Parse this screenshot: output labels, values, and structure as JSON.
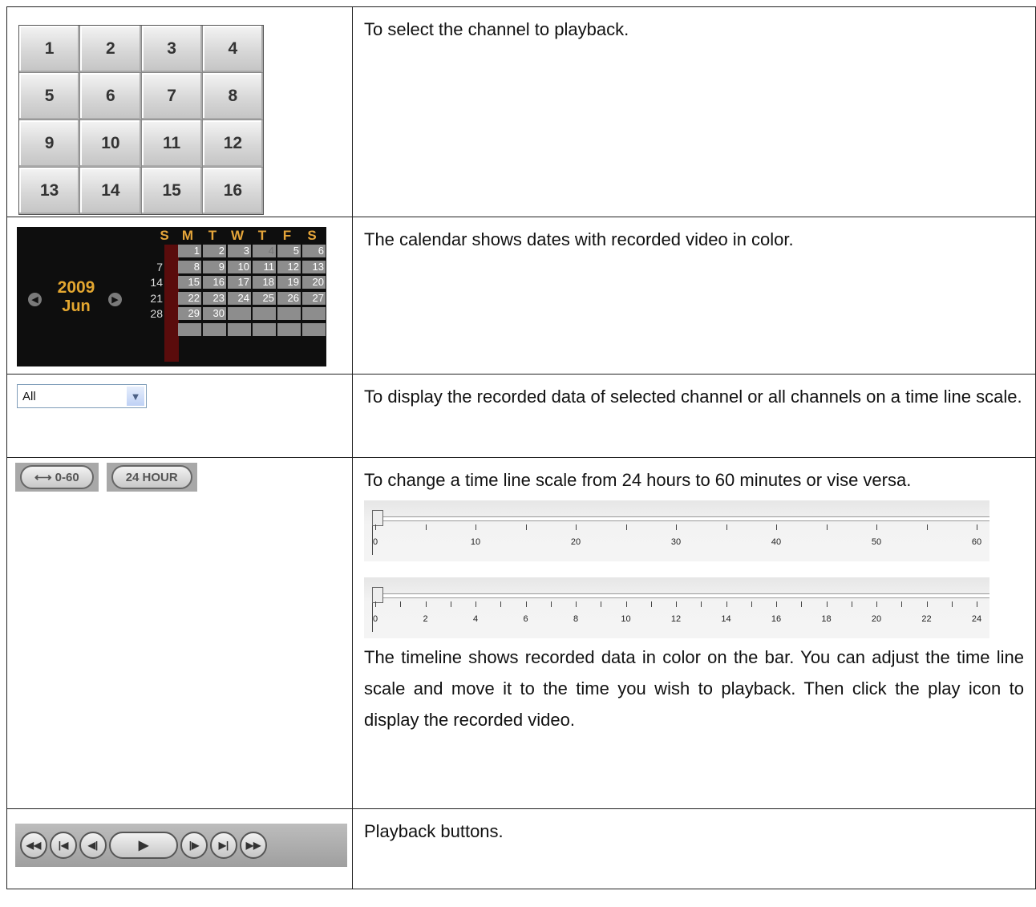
{
  "rows": {
    "channel": {
      "buttons": [
        "1",
        "2",
        "3",
        "4",
        "5",
        "6",
        "7",
        "8",
        "9",
        "10",
        "11",
        "12",
        "13",
        "14",
        "15",
        "16"
      ],
      "description": "To select the channel to playback."
    },
    "calendar": {
      "year": "2009",
      "month": "Jun",
      "day_headers": [
        "S",
        "M",
        "T",
        "W",
        "T",
        "F",
        "S"
      ],
      "week_labels": [
        "7",
        "14",
        "21",
        "28"
      ],
      "weeks": [
        [
          "",
          "1",
          "2",
          "3",
          "4",
          "5",
          "6"
        ],
        [
          "7",
          "8",
          "9",
          "10",
          "11",
          "12",
          "13"
        ],
        [
          "14",
          "15",
          "16",
          "17",
          "18",
          "19",
          "20"
        ],
        [
          "21",
          "22",
          "23",
          "24",
          "25",
          "26",
          "27"
        ],
        [
          "28",
          "29",
          "30",
          "",
          "",
          "",
          ""
        ],
        [
          "",
          "",
          "",
          "",
          "",
          "",
          ""
        ]
      ],
      "dim_days": [
        "4"
      ],
      "description": "The calendar shows dates with recorded video in color."
    },
    "selector": {
      "value": "All",
      "description": "To display the recorded data of selected channel or all channels on a time line scale."
    },
    "scale": {
      "button_minutes": "0-60",
      "button_hours": "24 HOUR",
      "description_1": "To change a time line scale from 24 hours to 60 minutes or vise versa.",
      "timeline_minutes_labels": [
        "0",
        "10",
        "20",
        "30",
        "40",
        "50",
        "60"
      ],
      "timeline_hours_labels": [
        "0",
        "2",
        "4",
        "6",
        "8",
        "10",
        "12",
        "14",
        "16",
        "18",
        "20",
        "22",
        "24"
      ],
      "description_2": "The timeline shows recorded data in color on the bar. You can adjust the time line scale and move it to the time you wish to playback. Then click the play icon to display the recorded video."
    },
    "playback": {
      "description": "Playback buttons."
    }
  },
  "icons": {
    "nav_prev": "chevron-left-icon",
    "nav_next": "chevron-right-icon",
    "dropdown": "chevron-down-icon",
    "playback": [
      "fast-rewind-icon",
      "skip-start-icon",
      "step-back-icon",
      "play-icon",
      "step-forward-icon",
      "skip-end-icon",
      "fast-forward-icon"
    ]
  }
}
